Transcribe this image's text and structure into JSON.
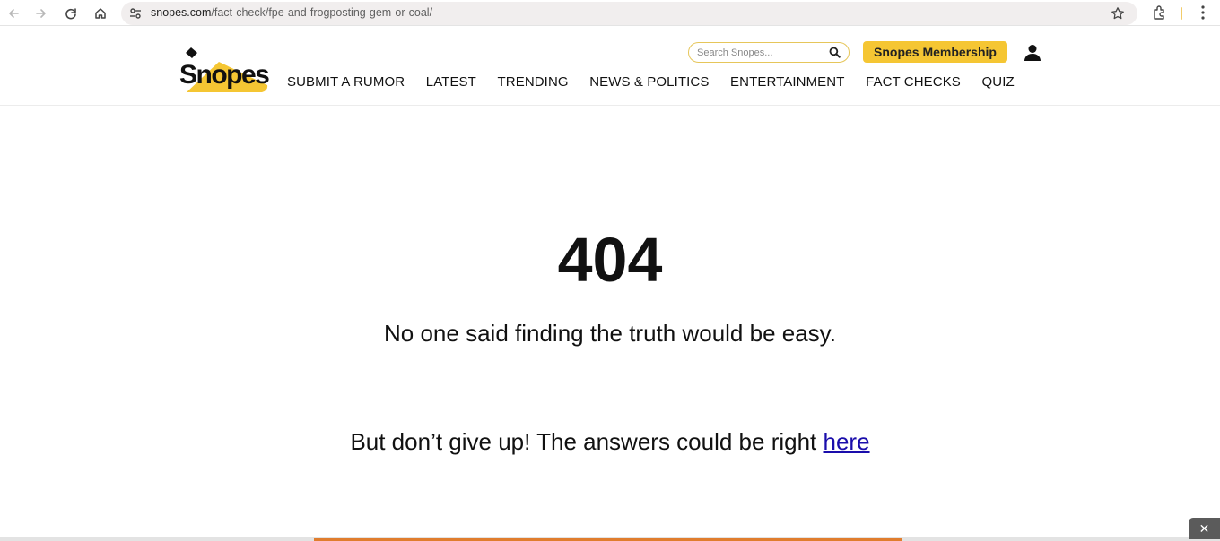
{
  "browser": {
    "url_host": "snopes.com",
    "url_path": "/fact-check/fpe-and-frogposting-gem-or-coal/"
  },
  "header": {
    "logo_text": "Snopes",
    "search_placeholder": "Search Snopes...",
    "membership_label": "Snopes Membership",
    "nav": [
      "SUBMIT A RUMOR",
      "LATEST",
      "TRENDING",
      "NEWS & POLITICS",
      "ENTERTAINMENT",
      "FACT CHECKS",
      "QUIZ"
    ]
  },
  "main": {
    "error_code": "404",
    "tagline": "No one said finding the truth would be easy.",
    "encourage_text": "But don’t give up! The answers could be right ",
    "encourage_link": "here"
  },
  "ad": {
    "close_label": "✕"
  },
  "colors": {
    "brand_yellow": "#f5c633",
    "link_blue": "#1a0dab",
    "ad_orange": "#e07d2e"
  }
}
